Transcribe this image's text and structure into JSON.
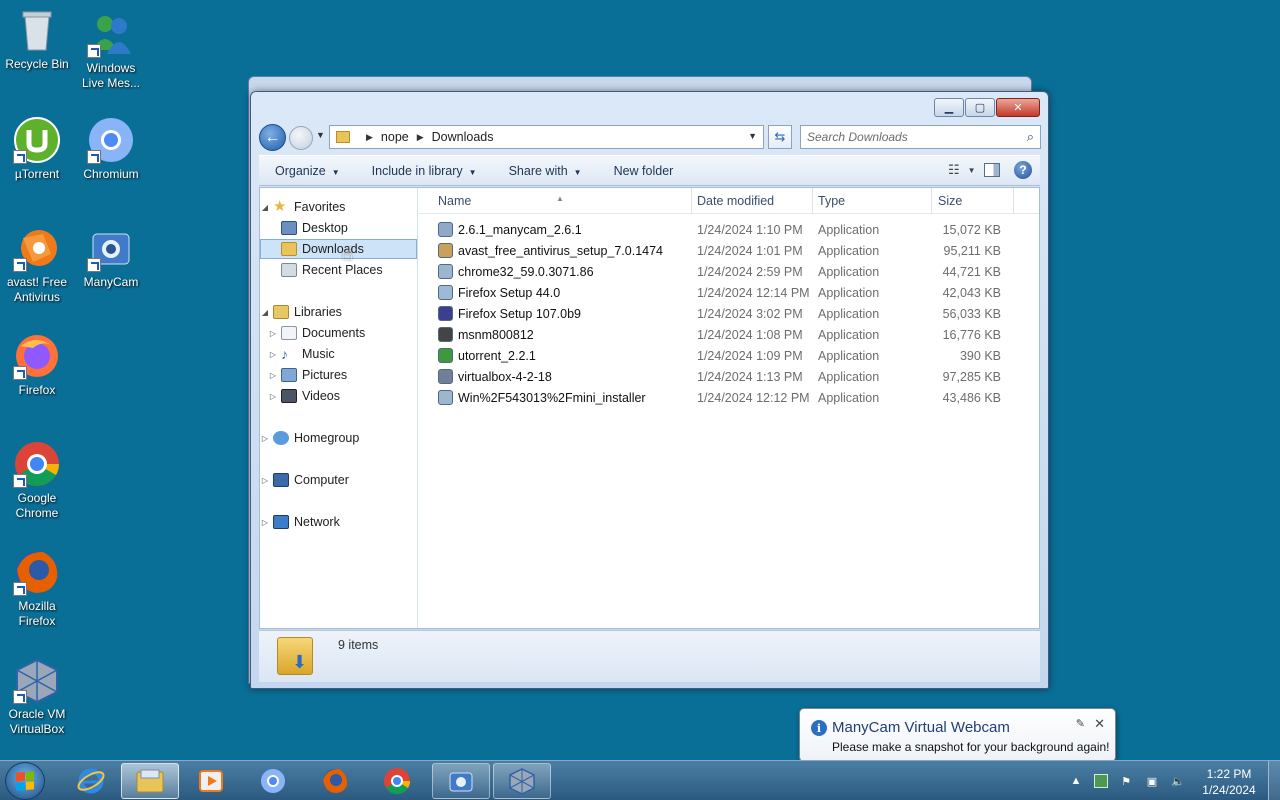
{
  "desktop": {
    "icons": [
      {
        "label": "Recycle Bin",
        "icon": "recycle-bin-icon",
        "color": "#cfd8de"
      },
      {
        "label": "Windows Live Mes...",
        "icon": "messenger-icon",
        "color": "#3aa34a"
      },
      {
        "label": "µTorrent",
        "icon": "utorrent-icon",
        "color": "#5fb02a"
      },
      {
        "label": "Chromium",
        "icon": "chromium-icon",
        "color": "#4c8bf5"
      },
      {
        "label": "avast! Free Antivirus",
        "icon": "avast-icon",
        "color": "#f07a1a"
      },
      {
        "label": "ManyCam",
        "icon": "manycam-icon",
        "color": "#3f7bc8"
      },
      {
        "label": "Firefox",
        "icon": "firefox-icon",
        "color": "#ff7139"
      },
      {
        "label": "Google Chrome",
        "icon": "chrome-icon",
        "color": "#db4437"
      },
      {
        "label": "Mozilla Firefox",
        "icon": "mozilla-firefox-icon",
        "color": "#e66000"
      },
      {
        "label": "Oracle VM VirtualBox",
        "icon": "virtualbox-icon",
        "color": "#2f63a8"
      }
    ]
  },
  "explorer": {
    "caption": {
      "minimize": "▁",
      "maximize": "▢",
      "close": "✕"
    },
    "address": {
      "segments": [
        "nope",
        "Downloads"
      ]
    },
    "search": {
      "placeholder": "Search Downloads"
    },
    "toolbar": {
      "organize": "Organize",
      "include_in_library": "Include in library",
      "share_with": "Share with",
      "new_folder": "New folder",
      "help": "?"
    },
    "nav": {
      "favorites": "Favorites",
      "desktop": "Desktop",
      "downloads": "Downloads",
      "recent_places": "Recent Places",
      "libraries": "Libraries",
      "documents": "Documents",
      "music": "Music",
      "pictures": "Pictures",
      "videos": "Videos",
      "homegroup": "Homegroup",
      "computer": "Computer",
      "network": "Network"
    },
    "columns": {
      "name": "Name",
      "date_modified": "Date modified",
      "type": "Type",
      "size": "Size"
    },
    "files": [
      {
        "name": "2.6.1_manycam_2.6.1",
        "date": "1/24/2024 1:10 PM",
        "type": "Application",
        "size": "15,072 KB",
        "color": "#8fa9c9"
      },
      {
        "name": "avast_free_antivirus_setup_7.0.1474",
        "date": "1/24/2024 1:01 PM",
        "type": "Application",
        "size": "95,211 KB",
        "color": "#c9a15a"
      },
      {
        "name": "chrome32_59.0.3071.86",
        "date": "1/24/2024 2:59 PM",
        "type": "Application",
        "size": "44,721 KB",
        "color": "#9db6cf"
      },
      {
        "name": "Firefox Setup 44.0",
        "date": "1/24/2024 12:14 PM",
        "type": "Application",
        "size": "42,043 KB",
        "color": "#9cb9da"
      },
      {
        "name": "Firefox Setup 107.0b9",
        "date": "1/24/2024 3:02 PM",
        "type": "Application",
        "size": "56,033 KB",
        "color": "#3a3f8f"
      },
      {
        "name": "msnm800812",
        "date": "1/24/2024 1:08 PM",
        "type": "Application",
        "size": "16,776 KB",
        "color": "#444444"
      },
      {
        "name": "utorrent_2.2.1",
        "date": "1/24/2024 1:09 PM",
        "type": "Application",
        "size": "390 KB",
        "color": "#3c9a3c"
      },
      {
        "name": "virtualbox-4-2-18",
        "date": "1/24/2024 1:13 PM",
        "type": "Application",
        "size": "97,285 KB",
        "color": "#6e7f96"
      },
      {
        "name": "Win%2F543013%2Fmini_installer",
        "date": "1/24/2024 12:12 PM",
        "type": "Application",
        "size": "43,486 KB",
        "color": "#9db6cf"
      }
    ],
    "details": {
      "count": "9 items"
    }
  },
  "notification": {
    "title": "ManyCam Virtual Webcam",
    "message": "Please make a snapshot for your background again!",
    "close": "✕"
  },
  "taskbar": {
    "clock_time": "1:22 PM",
    "clock_date": "1/24/2024"
  }
}
